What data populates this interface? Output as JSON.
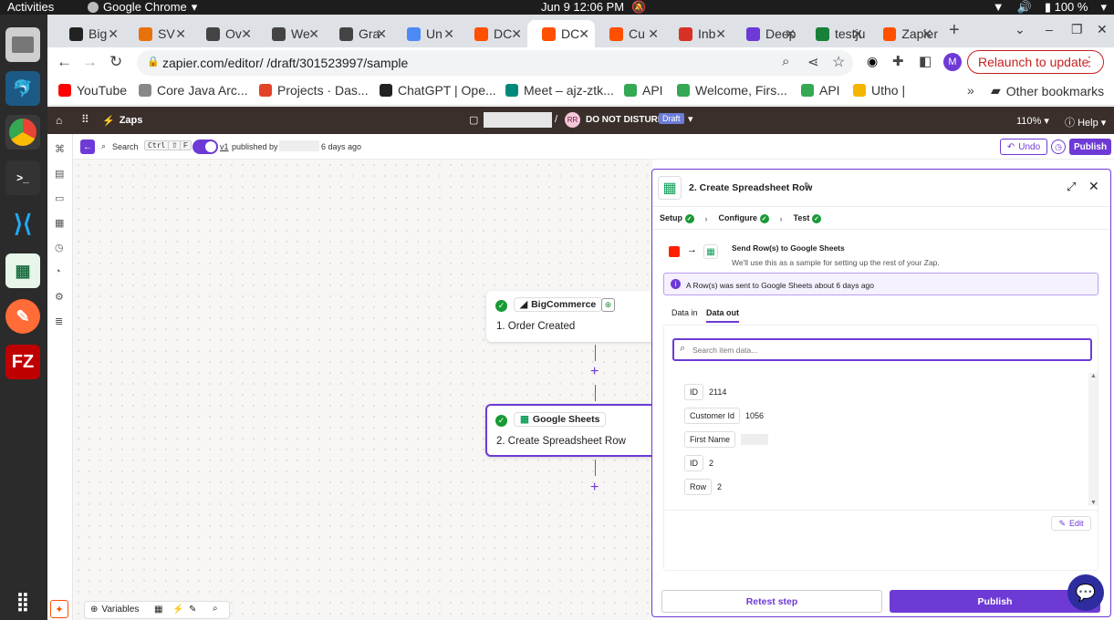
{
  "os": {
    "activities": "Activities",
    "app_name": "Google Chrome",
    "date_time": "Jun 9  12:06 PM",
    "battery": "100 %"
  },
  "tabs": [
    {
      "label": "Big",
      "color": "#222"
    },
    {
      "label": "SV",
      "color": "#e8710a"
    },
    {
      "label": "Ov",
      "color": "#444"
    },
    {
      "label": "We",
      "color": "#444"
    },
    {
      "label": "Gra",
      "color": "#444"
    },
    {
      "label": "Un",
      "color": "#4c8bf5"
    },
    {
      "label": "DC",
      "color": "#ff4f00"
    },
    {
      "label": "DC",
      "color": "#ff4f00"
    },
    {
      "label": "Cu",
      "color": "#ff4f00"
    },
    {
      "label": "Inb",
      "color": "#d93025"
    },
    {
      "label": "Deep",
      "color": "#6d3ad6"
    },
    {
      "label": "testju",
      "color": "#188038"
    },
    {
      "label": "Zapier",
      "color": "#ff4f00"
    }
  ],
  "address": {
    "url": "zapier.com/editor/                /draft/301523997/sample",
    "relaunch": "Relaunch to update",
    "profile": "M"
  },
  "bookmarks": [
    {
      "label": "YouTube",
      "color": "#ff0000"
    },
    {
      "label": "Core Java Arc...",
      "color": "#888"
    },
    {
      "label": "Projects · Das...",
      "color": "#e24329"
    },
    {
      "label": "ChatGPT | Ope...",
      "color": "#222"
    },
    {
      "label": "Meet – ajz-ztk...",
      "color": "#00897b"
    },
    {
      "label": "API",
      "color": "#34a853"
    },
    {
      "label": "Welcome, Firs...",
      "color": "#34a853"
    },
    {
      "label": "API",
      "color": "#34a853"
    },
    {
      "label": "Utho |",
      "color": "#f4b400"
    }
  ],
  "other_bookmarks": "Other bookmarks",
  "zap_header": {
    "zaps": "Zaps",
    "folder": "/",
    "user_initials": "RR",
    "zap_name": "DO NOT DISTURB",
    "status": "Draft",
    "zoom": "110%",
    "help": "Help"
  },
  "toolbar": {
    "search": "Search",
    "shortcut_1": "Ctrl",
    "shortcut_2": "⇧",
    "shortcut_3": "F",
    "version": "v1",
    "published_by": "published by",
    "ago": "6 days ago",
    "undo": "Undo",
    "publish": "Publish"
  },
  "nodes": [
    {
      "app": "BigCommerce",
      "step": "1. Order Created"
    },
    {
      "app": "Google Sheets",
      "step": "2. Create Spreadsheet Row"
    }
  ],
  "panel": {
    "title": "2. Create Spreadsheet Row",
    "steps": [
      "Setup",
      "Configure",
      "Test"
    ],
    "send_title": "Send Row(s) to Google Sheets",
    "send_sub": "We'll use this as a sample for setting up the rest of your Zap.",
    "info": "A Row(s) was sent to Google Sheets about 6 days ago",
    "tab_in": "Data in",
    "tab_out": "Data out",
    "search_placeholder": "Search item data...",
    "items": [
      {
        "key": "ID",
        "value": "2114"
      },
      {
        "key": "Customer Id",
        "value": "1056"
      },
      {
        "key": "First Name",
        "value": ""
      },
      {
        "key": "ID",
        "value": "2"
      },
      {
        "key": "Row",
        "value": "2"
      }
    ],
    "edit": "Edit",
    "retest": "Retest step",
    "publish": "Publish"
  },
  "bottom": {
    "variables": "Variables"
  }
}
